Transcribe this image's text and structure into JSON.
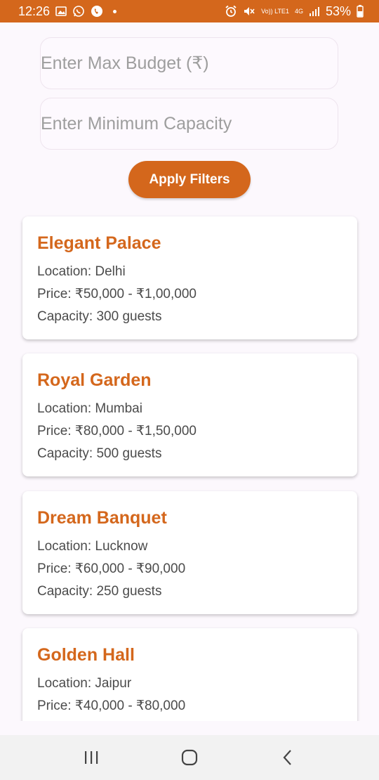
{
  "status": {
    "time": "12:26",
    "battery": "53%",
    "volte": "Vo)) LTE1",
    "net": "4G"
  },
  "filters": {
    "max_budget_placeholder": "Enter Max Budget (₹)",
    "min_capacity_placeholder": "Enter Minimum Capacity",
    "apply_label": "Apply Filters"
  },
  "venues": [
    {
      "name": "Elegant Palace",
      "location": "Location: Delhi",
      "price": "Price: ₹50,000 - ₹1,00,000",
      "capacity": "Capacity: 300 guests"
    },
    {
      "name": "Royal Garden",
      "location": "Location: Mumbai",
      "price": "Price: ₹80,000 - ₹1,50,000",
      "capacity": "Capacity: 500 guests"
    },
    {
      "name": "Dream Banquet",
      "location": "Location: Lucknow",
      "price": "Price: ₹60,000 - ₹90,000",
      "capacity": "Capacity: 250 guests"
    },
    {
      "name": "Golden Hall",
      "location": "Location: Jaipur",
      "price": "Price: ₹40,000 - ₹80,000",
      "capacity": ""
    }
  ],
  "colors": {
    "accent": "#d4671c",
    "background": "#fcf8fd",
    "card": "#ffffff"
  },
  "icons": {
    "status_left": [
      "gallery-icon",
      "whatsapp-icon",
      "call-app-icon",
      "notification-dot"
    ],
    "status_right": [
      "alarm-icon",
      "mute-icon",
      "signal-icon",
      "battery-icon"
    ],
    "nav": [
      "recent-apps-icon",
      "home-icon",
      "back-icon"
    ]
  }
}
